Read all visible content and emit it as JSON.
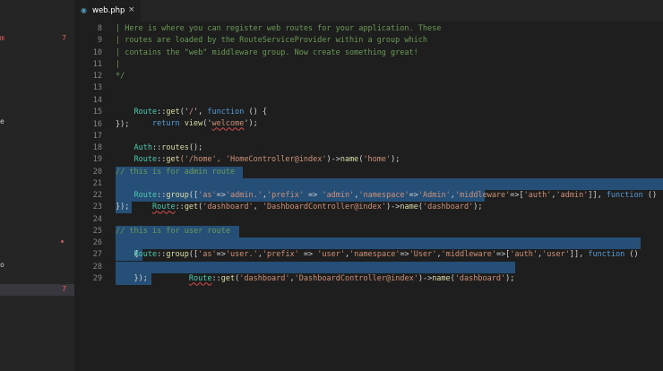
{
  "sidebar": {
    "items": [
      {
        "label": "m",
        "badge": "7"
      },
      {
        "label": "e",
        "badge": ""
      },
      {
        "label": "o",
        "badge": ""
      },
      {
        "label": "",
        "badge": "7"
      }
    ]
  },
  "tab": {
    "icon": "php-file-icon",
    "name": "web.php",
    "close": "×"
  },
  "gutter": [
    "8",
    "9",
    "10",
    "11",
    "12",
    "13",
    "14",
    "15",
    "16",
    "17",
    "18",
    "19",
    "20",
    "21",
    "22",
    "23",
    "24",
    "25",
    "26",
    "27",
    "28",
    "29"
  ],
  "code": {
    "l8": "| Here is where you can register web routes for your application. These",
    "l9": "| routes are loaded by the RouteServiceProvider within a group which",
    "l10": "| contains the \"web\" middleware group. Now create something great!",
    "l11": "|",
    "l12": "*/",
    "l14": [
      "Route",
      "::",
      "get",
      "('",
      "/",
      "', ",
      "function",
      " () {"
    ],
    "l15": [
      "    ",
      "return",
      " ",
      "view",
      "('",
      "welcome",
      "');"
    ],
    "l16": "});",
    "l17": [
      "Auth",
      "::",
      "routes",
      "();"
    ],
    "l18": [
      "Route",
      "::",
      "get",
      "('/home', ",
      "'HomeController@index'",
      ")->",
      "name",
      "(",
      "'home'",
      ");"
    ],
    "l20": "// this is for admin route",
    "l21": [
      "Route",
      "::",
      "group",
      "([",
      "'as'",
      "=>",
      "'admin.'",
      ",",
      "'prefix'",
      " => ",
      "'admin'",
      ",",
      "'namespace'",
      "=>",
      "'Admin'",
      ",",
      "'middleware'",
      "=>[",
      "'auth'",
      ",",
      "'admin'",
      "]], ",
      "function",
      " ()"
    ],
    "l22": [
      "    ",
      "Route",
      "::",
      "get",
      "(",
      "'dashboard'",
      ", ",
      "'DashboardController@index'",
      ")->",
      "name",
      "(",
      "'dashboard'",
      ");"
    ],
    "l23": "});",
    "l25": "// this is for user route",
    "l26": [
      "Route",
      "::",
      "group",
      "([",
      "'as'",
      "=>",
      "'user.'",
      ",",
      "'prefix'",
      " => ",
      "'user'",
      ",",
      "'namespace'",
      "=>",
      "'User'",
      ",",
      "'middleware'",
      "=>[",
      "'auth'",
      ",",
      "'user'",
      "]], ",
      "function",
      " ()"
    ],
    "l27": "    {",
    "l28": [
      "            ",
      "Route",
      "::",
      "get",
      "(",
      "'dashboard'",
      ",",
      "'DashboardController@index'",
      ")->",
      "name",
      "(",
      "'dashboard'",
      ");"
    ],
    "l29": "    });"
  }
}
